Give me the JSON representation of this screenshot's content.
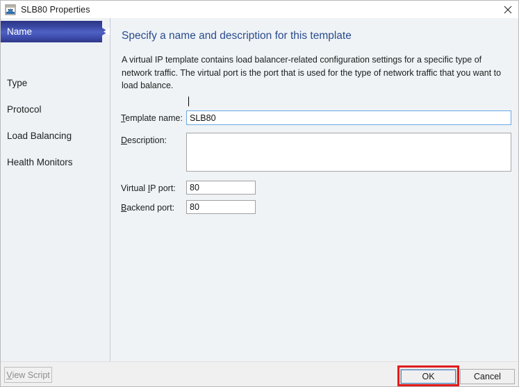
{
  "window": {
    "title": "SLB80 Properties",
    "icon": "network-load-balancer-icon",
    "close_label": "✕"
  },
  "sidebar": {
    "items": [
      {
        "label": "Name",
        "selected": true
      },
      {
        "label": "Type",
        "selected": false
      },
      {
        "label": "Protocol",
        "selected": false
      },
      {
        "label": "Load Balancing",
        "selected": false
      },
      {
        "label": "Health Monitors",
        "selected": false
      }
    ]
  },
  "main": {
    "heading": "Specify a name and description for this template",
    "description": "A virtual IP template contains load balancer-related configuration settings for a specific type of network traffic. The virtual port is the port that is used for the type of network traffic that you want to load balance.",
    "fields": {
      "template_name": {
        "label_prefix": "",
        "label_accel": "T",
        "label_suffix": "emplate name:",
        "value": "SLB80",
        "placeholder": ""
      },
      "description": {
        "label_prefix": "",
        "label_accel": "D",
        "label_suffix": "escription:",
        "value": "",
        "placeholder": ""
      },
      "virtual_ip_port": {
        "label_prefix": "Virtual ",
        "label_accel": "I",
        "label_suffix": "P port:",
        "value": "80",
        "placeholder": ""
      },
      "backend_port": {
        "label_prefix": "",
        "label_accel": "B",
        "label_suffix": "ackend port:",
        "value": "80",
        "placeholder": ""
      }
    }
  },
  "footer": {
    "view_script": {
      "label_prefix": "",
      "label_accel": "V",
      "label_suffix": "iew Script",
      "disabled": true
    },
    "ok": {
      "label": "OK",
      "default": true,
      "highlighted": true
    },
    "cancel": {
      "label": "Cancel"
    }
  },
  "colors": {
    "accent_blue": "#2a4b8d",
    "selection_blue": "#3a49a3",
    "highlight_red": "#e01b1b",
    "focus_border": "#6aa7e0",
    "pane_background": "#eff3f6",
    "sidebar_background": "#eef2f5",
    "footer_background": "#f0f0f0"
  }
}
